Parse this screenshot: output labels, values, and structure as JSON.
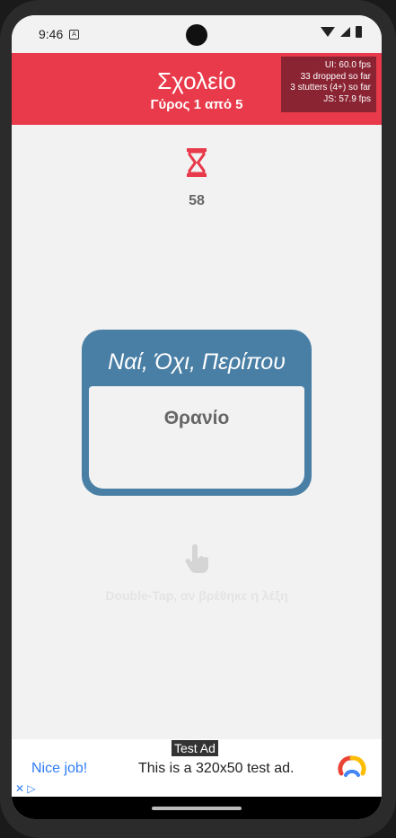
{
  "status": {
    "time": "9:46",
    "notif_glyph": "A"
  },
  "header": {
    "title": "Σχολείο",
    "round": "Γύρος 1 από 5",
    "perf": {
      "ui": "UI: 60.0 fps",
      "dropped": "33 dropped so far",
      "stutters": "3 stutters (4+) so far",
      "js": "JS: 57.9 fps"
    }
  },
  "timer": {
    "value": "58"
  },
  "card": {
    "title": "Ναί, Όχι, Περίπου",
    "word": "Θρανίο"
  },
  "hint": {
    "text": "Double-Tap, αν βρέθηκε η λέξη"
  },
  "ad": {
    "badge": "Test Ad",
    "left": "Nice job!",
    "text": "This is a 320x50 test ad."
  },
  "colors": {
    "header": "#e83a4a",
    "card": "#4a7fa5",
    "accent_icon": "#e83a4a"
  }
}
